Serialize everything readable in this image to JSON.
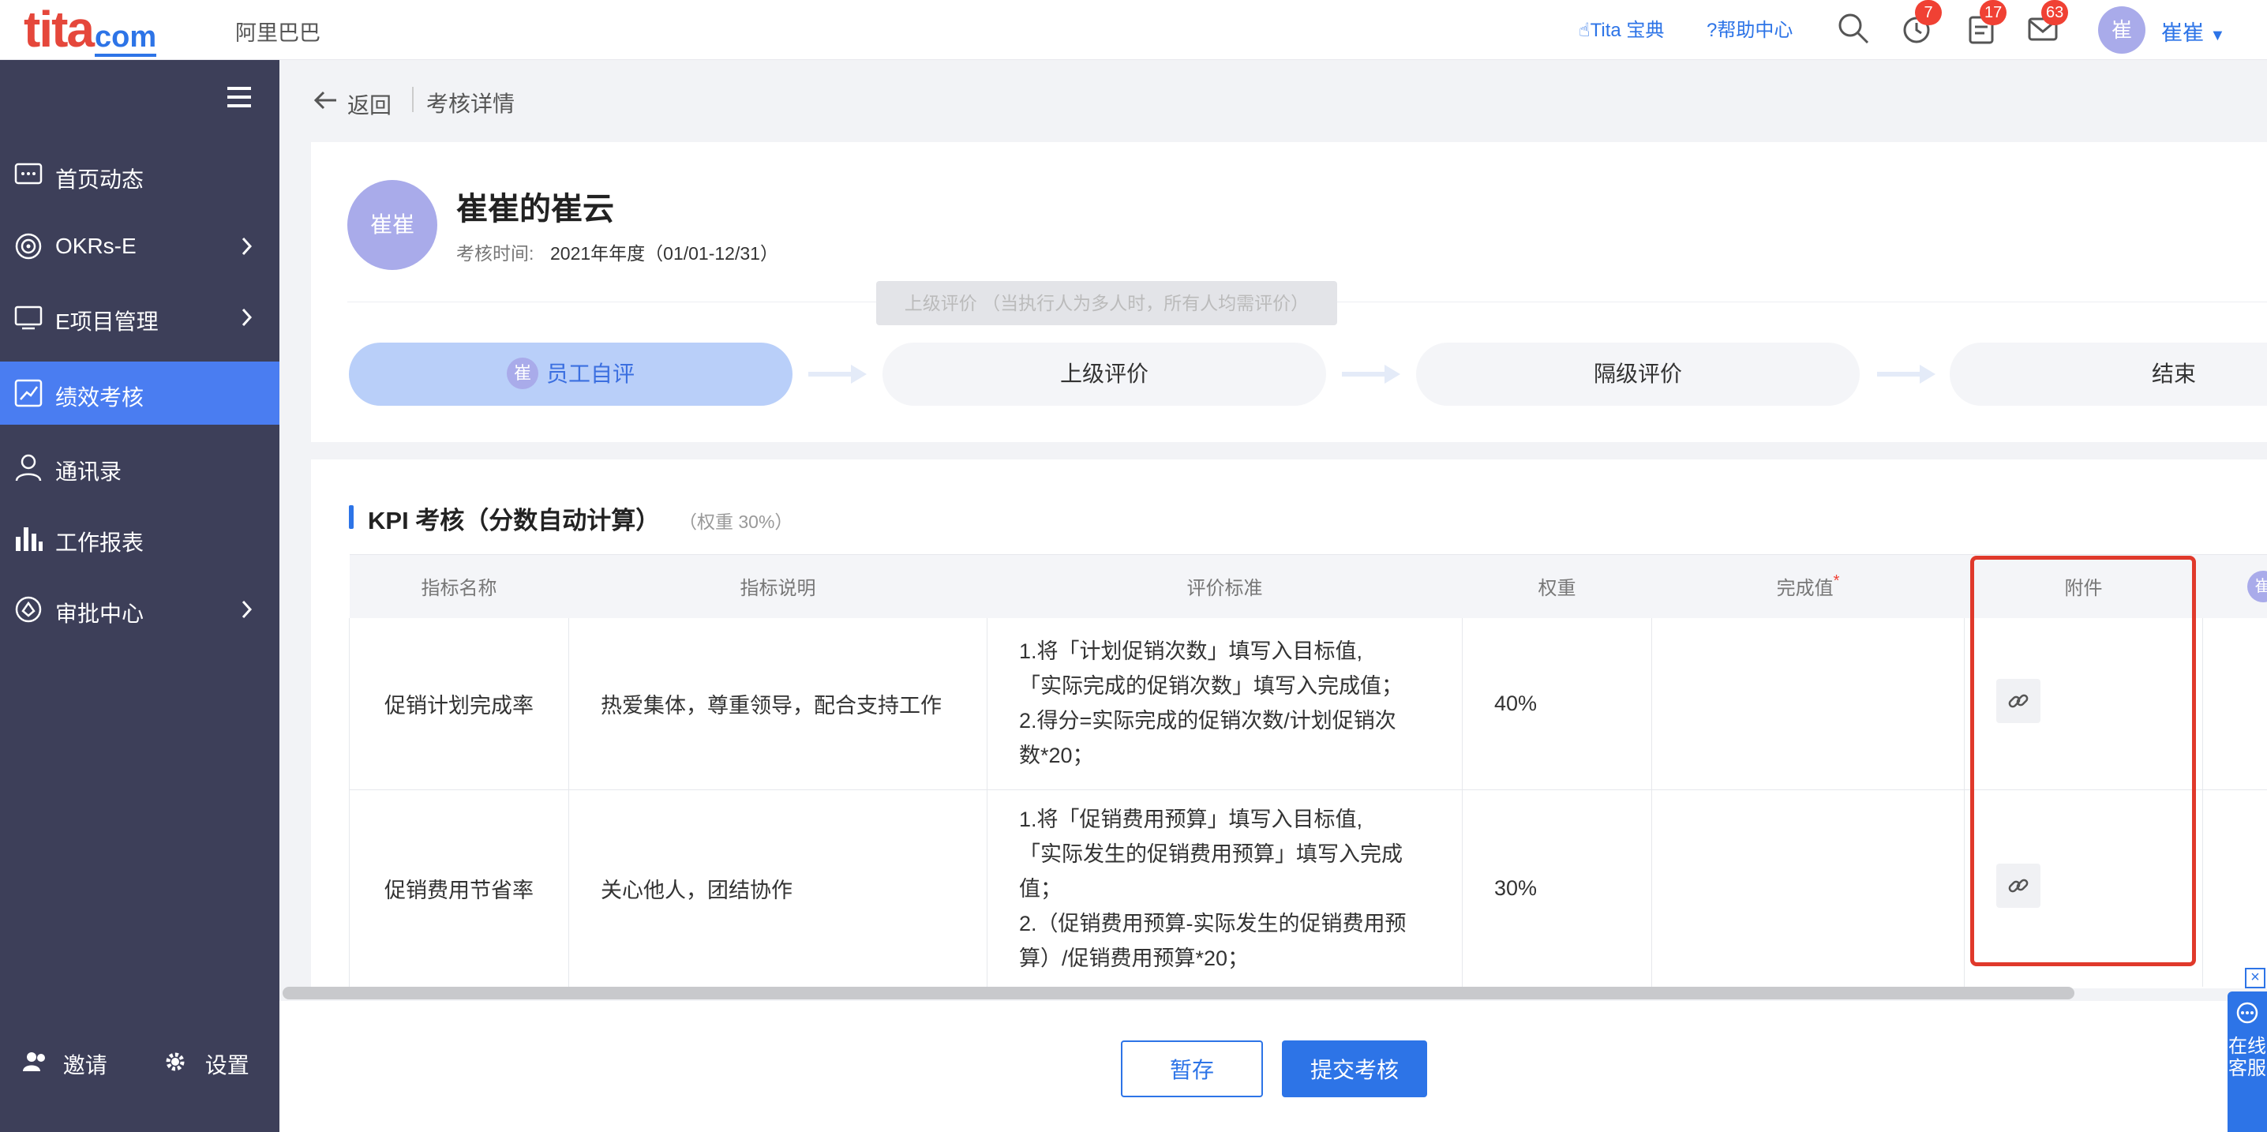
{
  "topbar": {
    "logo_main": "tita",
    "logo_domain": "com",
    "company": "阿里巴巴",
    "links": {
      "guide": "Tita 宝典",
      "help": "帮助中心"
    },
    "badges": {
      "reminders": "7",
      "tasks": "17",
      "messages": "63"
    },
    "avatar": "崔",
    "user": "崔崔"
  },
  "sidebar": {
    "items": [
      {
        "label": "首页动态",
        "icon": "chat-icon"
      },
      {
        "label": "OKRs-E",
        "icon": "target-icon"
      },
      {
        "label": "E项目管理",
        "icon": "monitor-icon"
      },
      {
        "label": "绩效考核",
        "icon": "trend-icon"
      },
      {
        "label": "通讯录",
        "icon": "person-icon"
      },
      {
        "label": "工作报表",
        "icon": "bar-chart-icon"
      },
      {
        "label": "审批中心",
        "icon": "approval-icon"
      }
    ],
    "invite": "邀请",
    "settings": "设置"
  },
  "breadcrumb": {
    "back": "返回",
    "title": "考核详情"
  },
  "header": {
    "avatar": "崔崔",
    "title": "崔崔的崔云",
    "period_label": "考核时间:",
    "period_value": "2021年年度（01/01-12/31）",
    "tooltip": "上级评价 （当执行人为多人时，所有人均需评价）",
    "steps": [
      {
        "label": "员工自评",
        "avatar": "崔",
        "active": true
      },
      {
        "label": "上级评价"
      },
      {
        "label": "隔级评价"
      },
      {
        "label": "结束"
      }
    ]
  },
  "kpi": {
    "title": "KPI 考核（分数自动计算）",
    "weight": "（权重 30%）",
    "columns": [
      "指标名称",
      "指标说明",
      "评价标准",
      "权重",
      "完成值",
      "附件"
    ],
    "required_mark": "*",
    "rows": [
      {
        "name": "促销计划完成率",
        "desc": "热爱集体，尊重领导，配合支持工作",
        "criteria": [
          "1.将「计划促销次数」填写入目标值,",
          "「实际完成的促销次数」填写入完成值；",
          "2.得分=实际完成的促销次数/计划促销次",
          "数*20；"
        ],
        "weight": "40%",
        "done": ""
      },
      {
        "name": "促销费用节省率",
        "desc": "关心他人，团结协作",
        "criteria": [
          "1.将「促销费用预算」填写入目标值,",
          "「实际发生的促销费用预算」填写入完成",
          "值；",
          "2.（促销费用预算-实际发生的促销费用预",
          "算）/促销费用预算*20；"
        ],
        "weight": "30%",
        "done": ""
      }
    ],
    "right_avatar": "崔"
  },
  "footer": {
    "save": "暂存",
    "submit": "提交考核"
  },
  "service": {
    "label": "在线客服",
    "close": "×"
  },
  "colors": {
    "primary": "#2d74e7",
    "sidebar": "#3d3f59",
    "active_nav": "#4a7df1",
    "highlight": "#e0392b",
    "badge": "#f04134"
  }
}
